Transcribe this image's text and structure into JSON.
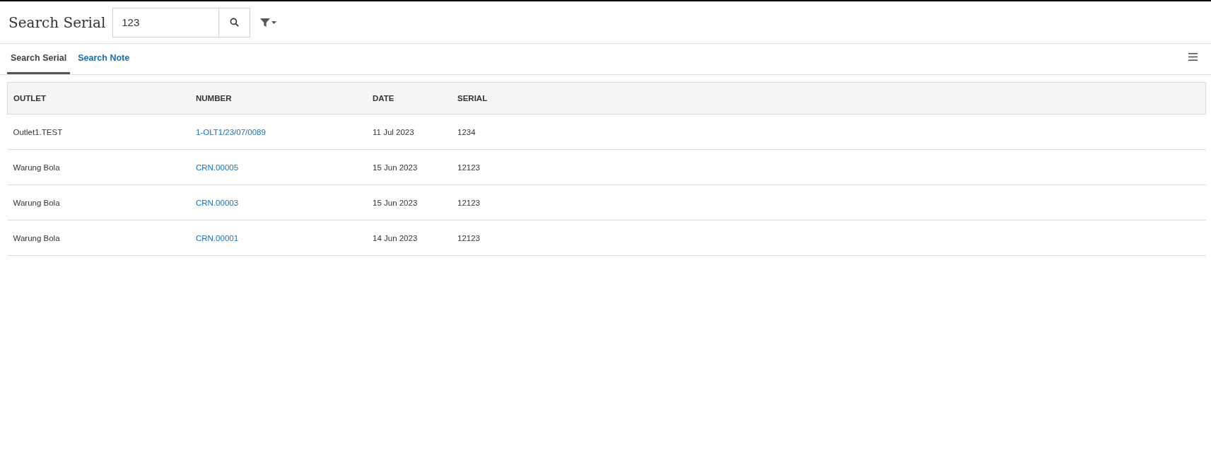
{
  "header": {
    "title": "Search Serial",
    "search": {
      "value": "123"
    }
  },
  "tabs": [
    {
      "label": "Search Serial",
      "selected": true
    },
    {
      "label": "Search Note",
      "selected": false
    }
  ],
  "table": {
    "columns": [
      "OUTLET",
      "NUMBER",
      "DATE",
      "SERIAL"
    ],
    "rows": [
      {
        "outlet": "Outlet1.TEST",
        "number": "1-OLT1/23/07/0089",
        "date": "11 Jul 2023",
        "serial": "1234"
      },
      {
        "outlet": "Warung Bola",
        "number": "CRN.00005",
        "date": "15 Jun 2023",
        "serial": "12123"
      },
      {
        "outlet": "Warung Bola",
        "number": "CRN.00003",
        "date": "15 Jun 2023",
        "serial": "12123"
      },
      {
        "outlet": "Warung Bola",
        "number": "CRN.00001",
        "date": "14 Jun 2023",
        "serial": "12123"
      }
    ]
  }
}
